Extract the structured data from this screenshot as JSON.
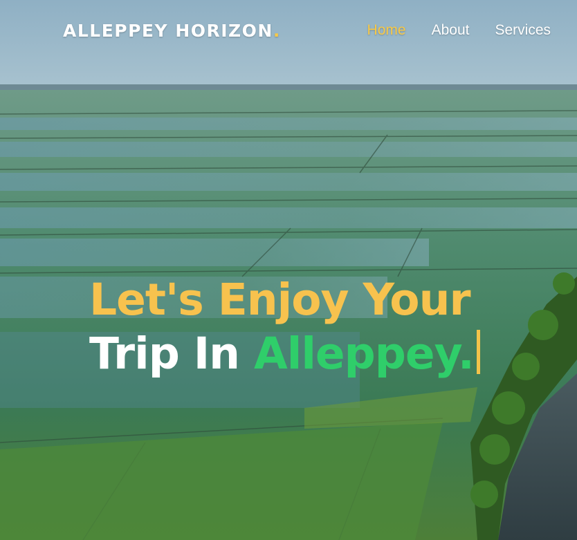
{
  "brand": {
    "name": "ALLEPPEY HORIZON",
    "dot": "."
  },
  "nav": {
    "items": [
      {
        "label": "Home",
        "active": true
      },
      {
        "label": "About",
        "active": false
      },
      {
        "label": "Services",
        "active": false
      }
    ]
  },
  "hero": {
    "line1": "Let's Enjoy Your",
    "line2_prefix": "Trip In ",
    "line2_accent": "Alleppey."
  },
  "colors": {
    "accent_yellow": "#f7c948",
    "accent_green": "#2fce6a",
    "text_white": "#ffffff"
  }
}
